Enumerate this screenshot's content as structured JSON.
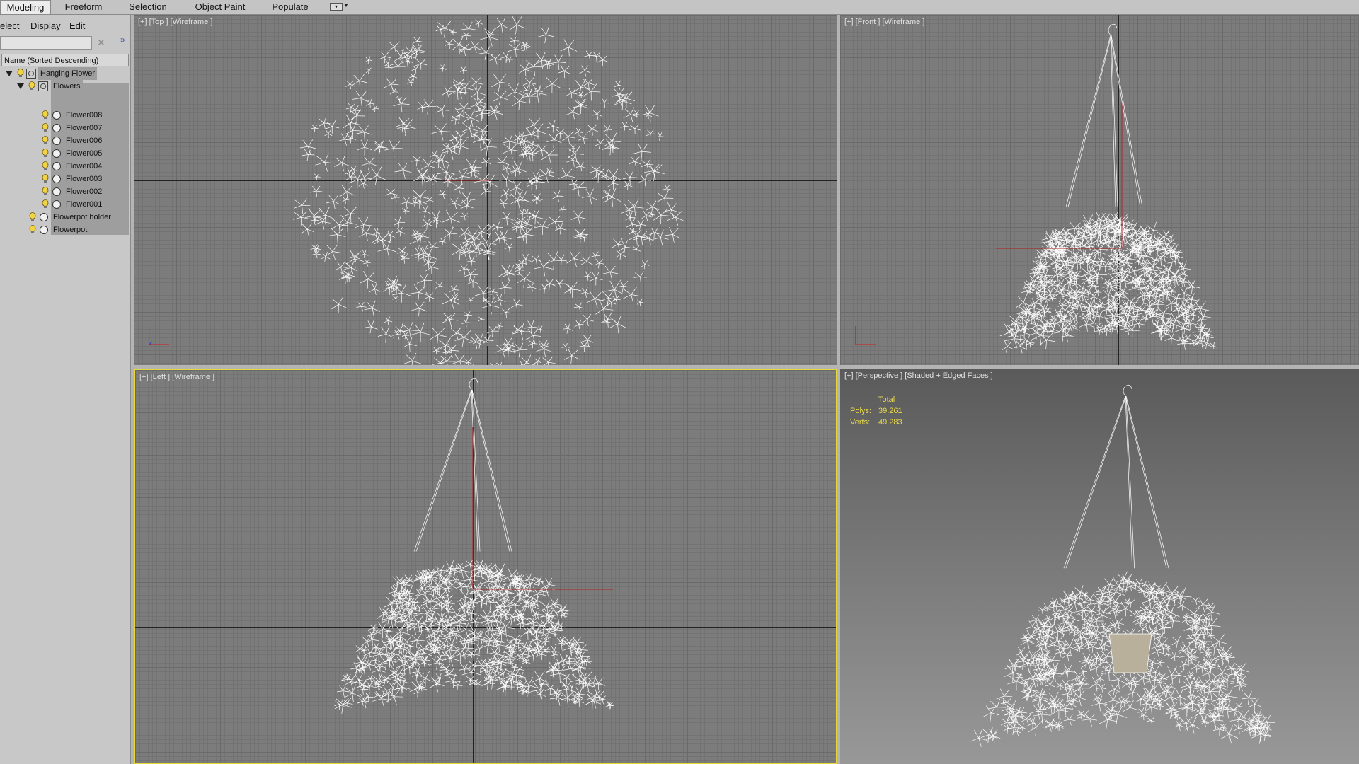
{
  "ribbon": {
    "tabs": [
      {
        "label": "Modeling",
        "active": true
      },
      {
        "label": "Freeform",
        "active": false
      },
      {
        "label": "Selection",
        "active": false
      },
      {
        "label": "Object Paint",
        "active": false
      },
      {
        "label": "Populate",
        "active": false
      }
    ]
  },
  "explorer": {
    "menu": {
      "select": "elect",
      "display": "Display",
      "edit": "Edit"
    },
    "search_value": "",
    "column_header": "Name (Sorted Descending)",
    "tree": [
      {
        "label": "Hanging Flower",
        "level": 0,
        "type": "group",
        "expanded": true
      },
      {
        "label": "Flowers",
        "level": 1,
        "type": "group",
        "expanded": true
      },
      {
        "label": "Flower008",
        "level": 2,
        "type": "object"
      },
      {
        "label": "Flower007",
        "level": 2,
        "type": "object"
      },
      {
        "label": "Flower006",
        "level": 2,
        "type": "object"
      },
      {
        "label": "Flower005",
        "level": 2,
        "type": "object"
      },
      {
        "label": "Flower004",
        "level": 2,
        "type": "object"
      },
      {
        "label": "Flower003",
        "level": 2,
        "type": "object"
      },
      {
        "label": "Flower002",
        "level": 2,
        "type": "object"
      },
      {
        "label": "Flower001",
        "level": 2,
        "type": "object"
      },
      {
        "label": "Flowerpot holder",
        "level": 1,
        "type": "object"
      },
      {
        "label": "Flowerpot",
        "level": 1,
        "type": "object"
      }
    ]
  },
  "viewports": {
    "top": {
      "label": "[+] [Top ] [Wireframe ]",
      "axes": "x / y"
    },
    "front": {
      "label": "[+] [Front ] [Wireframe ]",
      "axes": "x / z"
    },
    "left": {
      "label": "[+] [Left ] [Wireframe ]",
      "active": true
    },
    "perspective": {
      "label": "[+] [Perspective ] [Shaded + Edged Faces ]",
      "stats": {
        "header": "Total",
        "polys_label": "Polys:",
        "polys_value": "39.261",
        "verts_label": "Verts:",
        "verts_value": "49.283"
      }
    }
  },
  "colors": {
    "active_viewport_border": "#e6d73b",
    "stats_text": "#e9d84a",
    "wireframe": "#ffffff",
    "grid": "#7c7c7c"
  }
}
